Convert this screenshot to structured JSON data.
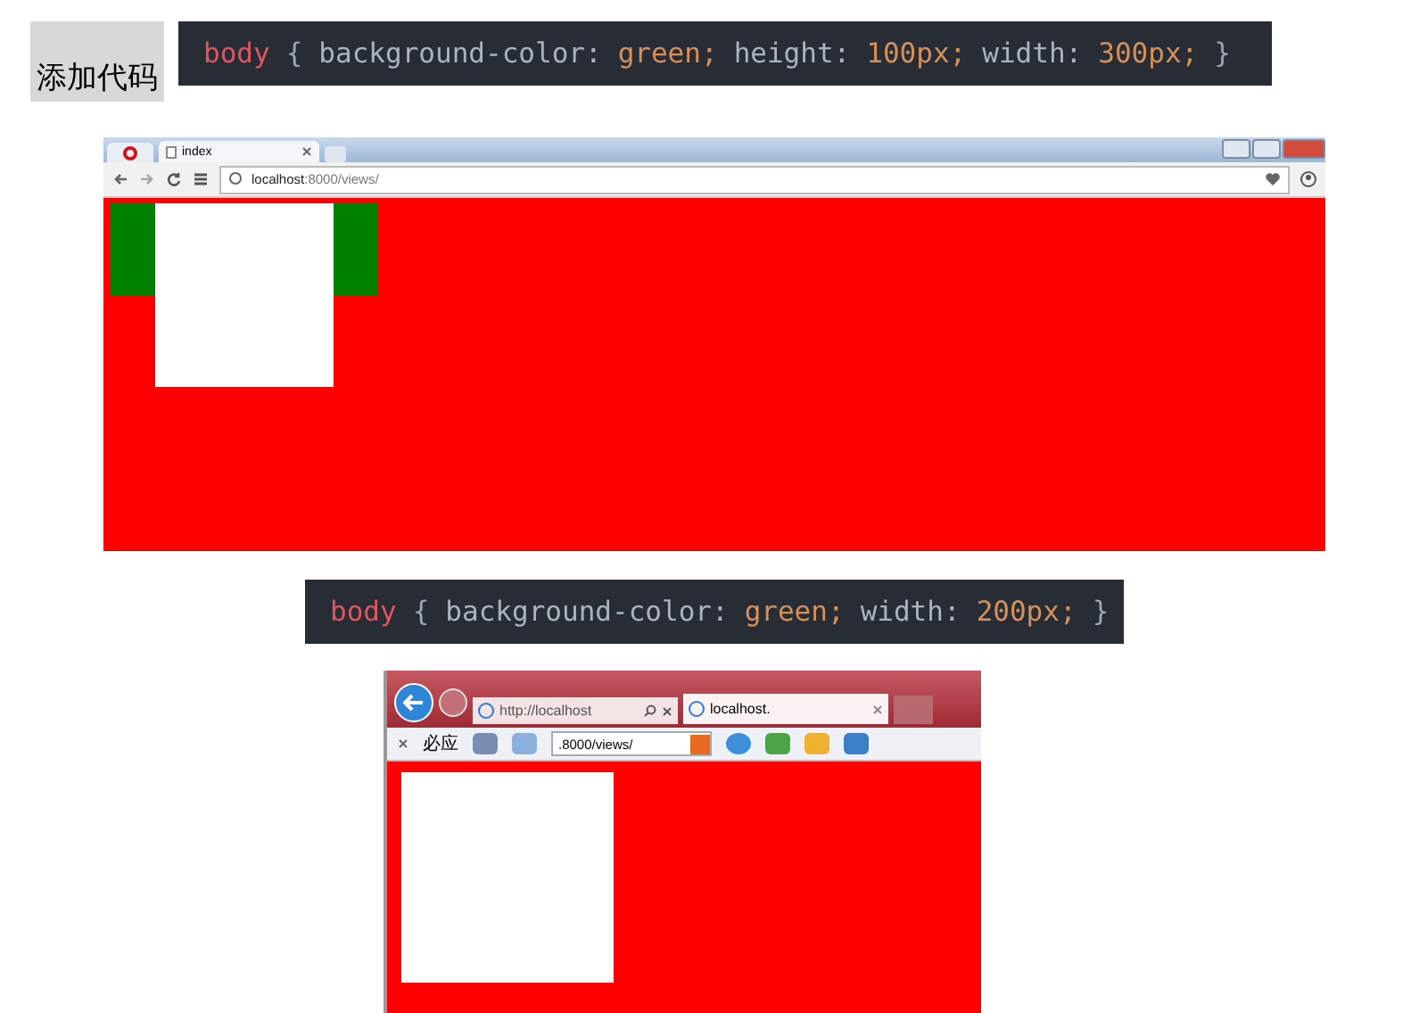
{
  "intro_label": "添加代码",
  "code_1": {
    "tokens": [
      {
        "kind": "selector",
        "text": "body"
      },
      {
        "kind": "brace",
        "text": "{"
      },
      {
        "kind": "property",
        "text": "background-color:"
      },
      {
        "kind": "value",
        "text": "green;"
      },
      {
        "kind": "property",
        "text": "height:"
      },
      {
        "kind": "value",
        "text": "100px;"
      },
      {
        "kind": "property",
        "text": "width:"
      },
      {
        "kind": "value",
        "text": "300px;"
      },
      {
        "kind": "brace",
        "text": "}"
      }
    ]
  },
  "screenshot_1": {
    "tab": "index",
    "address_host": "localhost",
    "address_path": ":8000/views/"
  },
  "code_2": {
    "tokens": [
      {
        "kind": "selector",
        "text": "body"
      },
      {
        "kind": "brace",
        "text": "{"
      },
      {
        "kind": "property",
        "text": "background-color:"
      },
      {
        "kind": "value",
        "text": "green;"
      },
      {
        "kind": "property",
        "text": "width:"
      },
      {
        "kind": "value",
        "text": "200px;"
      },
      {
        "kind": "brace",
        "text": "}"
      }
    ]
  },
  "screenshot_2": {
    "address": "http://localhost",
    "tab": "localhost.",
    "bing": "必应",
    "address_path": ".8000/views/"
  }
}
